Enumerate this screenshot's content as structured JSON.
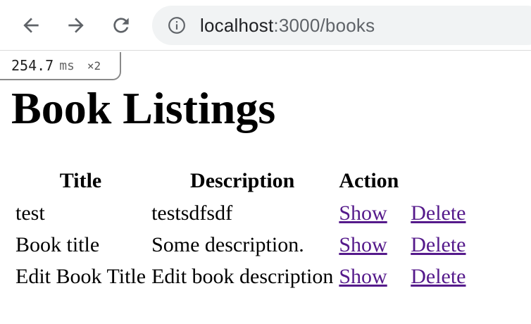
{
  "browser": {
    "url_host": "localhost",
    "url_rest": ":3000/books",
    "icons": {
      "back": "back-arrow-icon",
      "forward": "forward-arrow-icon",
      "reload": "reload-icon",
      "info": "info-icon"
    }
  },
  "perf": {
    "value": "254.7",
    "unit": "ms",
    "multiplier": "×2"
  },
  "page": {
    "title": "Book Listings"
  },
  "table": {
    "headers": [
      "Title",
      "Description",
      "Action"
    ],
    "rows": [
      {
        "title": "test",
        "description": "testsdfsdf",
        "show": "Show",
        "delete": "Delete"
      },
      {
        "title": "Book title",
        "description": "Some description.",
        "show": "Show",
        "delete": "Delete"
      },
      {
        "title": "Edit Book Title",
        "description": "Edit book description",
        "show": "Show",
        "delete": "Delete"
      }
    ]
  },
  "colors": {
    "link_visited": "#551a8b",
    "omnibox_bg": "#f1f3f4",
    "icon": "#5f6368"
  }
}
